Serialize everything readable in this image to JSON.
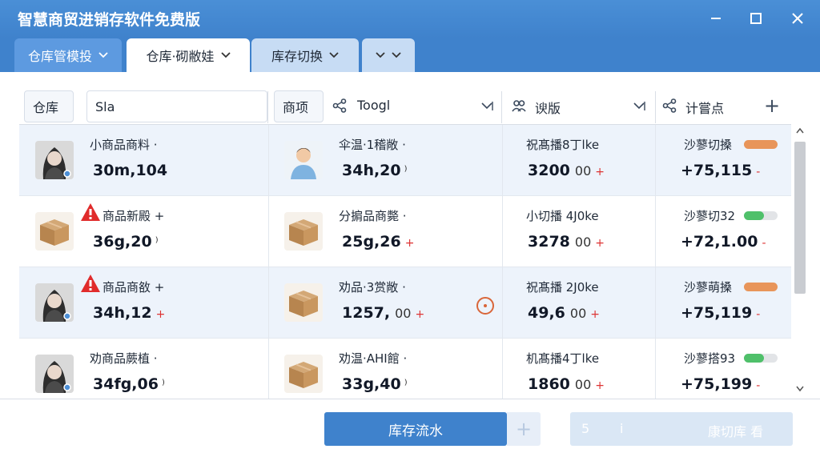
{
  "window": {
    "title": "智慧商贸进销存软件免费版"
  },
  "tabs": [
    {
      "label": "仓库管模投"
    },
    {
      "label": "仓库·砌敝娃"
    },
    {
      "label": "库存切换"
    },
    {
      "label": ""
    }
  ],
  "filters": {
    "warehouse_label": "仓库",
    "warehouse_value": "Sla",
    "product_label": "商项",
    "toggle_label": "Toogl",
    "version_label": "谀版",
    "count_label": "计嘗点"
  },
  "rows": [
    {
      "c1": {
        "name": "小商品商料 ·",
        "qty": "30m,104",
        "avatar": "woman-photo-icon"
      },
      "c2": {
        "name": "伞温·1稽敞 ·",
        "qty": "34h,20",
        "tail": "⁾",
        "avatar": "man-photo-icon"
      },
      "c3": {
        "name": "祝髙播8丁lke",
        "qty": "3200",
        "unit": "00",
        "sign": "+"
      },
      "c4": {
        "name": "沙蓼切搡",
        "qty": "+75,115",
        "sign": "-",
        "pill": "#e8955a",
        "pillfill": 1.0
      }
    },
    {
      "c1": {
        "name": "商品新殿 +",
        "qty": "36g,20",
        "tail": "⁾",
        "avatar": "box-icon",
        "warn": true
      },
      "c2": {
        "name": "分掮品商斃 ·",
        "qty": "25g,26",
        "sign": "+",
        "avatar": "box-icon"
      },
      "c3": {
        "name": "小切播 4J0ke",
        "qty": "3278",
        "unit": "00",
        "sign": "+"
      },
      "c4": {
        "name": "沙蓼切32",
        "qty": "+72,1.00",
        "sign": "-",
        "pill": "#4fc06a",
        "pillfill": 0.6
      }
    },
    {
      "c1": {
        "name": "商品商敋 +",
        "qty": "34h,12",
        "sign": "+",
        "avatar": "woman-photo-icon",
        "warn": true
      },
      "c2": {
        "name": "劝品·3赏敞 ·",
        "qty": "1257,",
        "unit": "00",
        "sign": "+",
        "avatar": "box-icon",
        "target": true
      },
      "c3": {
        "name": "祝髙播 2J0ke",
        "qty": "49,6",
        "unit": "00",
        "sign": "+"
      },
      "c4": {
        "name": "沙蓼萌搡",
        "qty": "+75,119",
        "sign": "-",
        "pill": "#e8955a",
        "pillfill": 1.0
      }
    },
    {
      "c1": {
        "name": "劝商品蕨植 ·",
        "qty": "34fg,06",
        "tail": "⁾",
        "avatar": "woman-photo-icon"
      },
      "c2": {
        "name": "劝温·AHI館 ·",
        "qty": "33g,40",
        "tail": "⁾",
        "avatar": "box-icon"
      },
      "c3": {
        "name": "机髙播4丁lke",
        "qty": "1860",
        "unit": "00",
        "sign": "+"
      },
      "c4": {
        "name": "沙蓼搭93",
        "qty": "+75,199",
        "sign": "-",
        "pill": "#4fc06a",
        "pillfill": 0.6
      }
    }
  ],
  "bottom": {
    "main_button": "库存流水",
    "plus": "+",
    "pager_a": "5",
    "pager_b": "i",
    "pager_c": "康切库 看"
  }
}
